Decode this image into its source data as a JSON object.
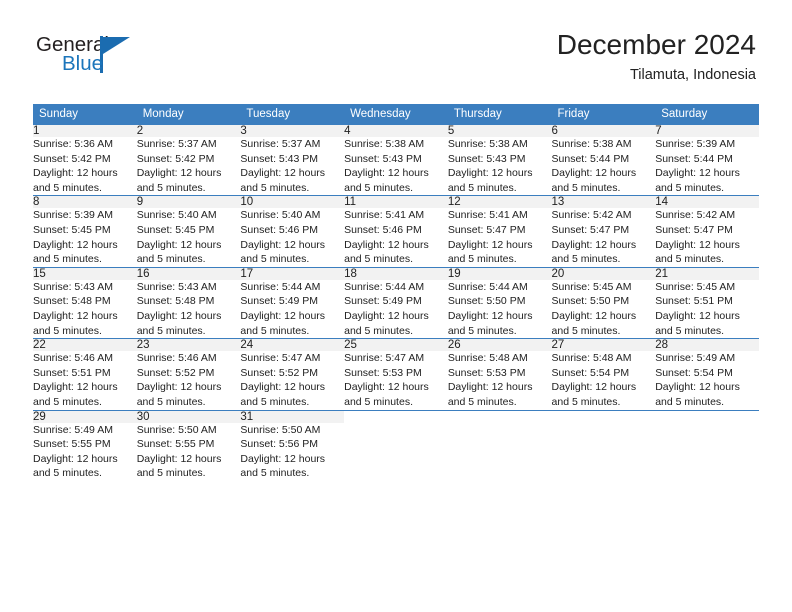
{
  "logo": {
    "primary_text": "General",
    "secondary_text": "Blue",
    "primary_color": "#231f20",
    "secondary_color": "#1b75bb",
    "accent_color": "#1b6cb0",
    "icon": "triangle-flag-icon"
  },
  "header": {
    "title": "December 2024",
    "subtitle": "Tilamuta, Indonesia"
  },
  "theme": {
    "header_row_bg": "#3b7ebf",
    "daynum_bg": "#f2f2f2",
    "text_color": "#222222",
    "cell_bg": "#ffffff"
  },
  "calendar": {
    "weekdays": [
      "Sunday",
      "Monday",
      "Tuesday",
      "Wednesday",
      "Thursday",
      "Friday",
      "Saturday"
    ],
    "labels": {
      "sunrise": "Sunrise:",
      "sunset": "Sunset:",
      "daylight": "Daylight:"
    },
    "weeks": [
      [
        {
          "day": "1",
          "sunrise": "Sunrise: 5:36 AM",
          "sunset": "Sunset: 5:42 PM",
          "daylight_a": "Daylight: 12 hours",
          "daylight_b": "and 5 minutes."
        },
        {
          "day": "2",
          "sunrise": "Sunrise: 5:37 AM",
          "sunset": "Sunset: 5:42 PM",
          "daylight_a": "Daylight: 12 hours",
          "daylight_b": "and 5 minutes."
        },
        {
          "day": "3",
          "sunrise": "Sunrise: 5:37 AM",
          "sunset": "Sunset: 5:43 PM",
          "daylight_a": "Daylight: 12 hours",
          "daylight_b": "and 5 minutes."
        },
        {
          "day": "4",
          "sunrise": "Sunrise: 5:38 AM",
          "sunset": "Sunset: 5:43 PM",
          "daylight_a": "Daylight: 12 hours",
          "daylight_b": "and 5 minutes."
        },
        {
          "day": "5",
          "sunrise": "Sunrise: 5:38 AM",
          "sunset": "Sunset: 5:43 PM",
          "daylight_a": "Daylight: 12 hours",
          "daylight_b": "and 5 minutes."
        },
        {
          "day": "6",
          "sunrise": "Sunrise: 5:38 AM",
          "sunset": "Sunset: 5:44 PM",
          "daylight_a": "Daylight: 12 hours",
          "daylight_b": "and 5 minutes."
        },
        {
          "day": "7",
          "sunrise": "Sunrise: 5:39 AM",
          "sunset": "Sunset: 5:44 PM",
          "daylight_a": "Daylight: 12 hours",
          "daylight_b": "and 5 minutes."
        }
      ],
      [
        {
          "day": "8",
          "sunrise": "Sunrise: 5:39 AM",
          "sunset": "Sunset: 5:45 PM",
          "daylight_a": "Daylight: 12 hours",
          "daylight_b": "and 5 minutes."
        },
        {
          "day": "9",
          "sunrise": "Sunrise: 5:40 AM",
          "sunset": "Sunset: 5:45 PM",
          "daylight_a": "Daylight: 12 hours",
          "daylight_b": "and 5 minutes."
        },
        {
          "day": "10",
          "sunrise": "Sunrise: 5:40 AM",
          "sunset": "Sunset: 5:46 PM",
          "daylight_a": "Daylight: 12 hours",
          "daylight_b": "and 5 minutes."
        },
        {
          "day": "11",
          "sunrise": "Sunrise: 5:41 AM",
          "sunset": "Sunset: 5:46 PM",
          "daylight_a": "Daylight: 12 hours",
          "daylight_b": "and 5 minutes."
        },
        {
          "day": "12",
          "sunrise": "Sunrise: 5:41 AM",
          "sunset": "Sunset: 5:47 PM",
          "daylight_a": "Daylight: 12 hours",
          "daylight_b": "and 5 minutes."
        },
        {
          "day": "13",
          "sunrise": "Sunrise: 5:42 AM",
          "sunset": "Sunset: 5:47 PM",
          "daylight_a": "Daylight: 12 hours",
          "daylight_b": "and 5 minutes."
        },
        {
          "day": "14",
          "sunrise": "Sunrise: 5:42 AM",
          "sunset": "Sunset: 5:47 PM",
          "daylight_a": "Daylight: 12 hours",
          "daylight_b": "and 5 minutes."
        }
      ],
      [
        {
          "day": "15",
          "sunrise": "Sunrise: 5:43 AM",
          "sunset": "Sunset: 5:48 PM",
          "daylight_a": "Daylight: 12 hours",
          "daylight_b": "and 5 minutes."
        },
        {
          "day": "16",
          "sunrise": "Sunrise: 5:43 AM",
          "sunset": "Sunset: 5:48 PM",
          "daylight_a": "Daylight: 12 hours",
          "daylight_b": "and 5 minutes."
        },
        {
          "day": "17",
          "sunrise": "Sunrise: 5:44 AM",
          "sunset": "Sunset: 5:49 PM",
          "daylight_a": "Daylight: 12 hours",
          "daylight_b": "and 5 minutes."
        },
        {
          "day": "18",
          "sunrise": "Sunrise: 5:44 AM",
          "sunset": "Sunset: 5:49 PM",
          "daylight_a": "Daylight: 12 hours",
          "daylight_b": "and 5 minutes."
        },
        {
          "day": "19",
          "sunrise": "Sunrise: 5:44 AM",
          "sunset": "Sunset: 5:50 PM",
          "daylight_a": "Daylight: 12 hours",
          "daylight_b": "and 5 minutes."
        },
        {
          "day": "20",
          "sunrise": "Sunrise: 5:45 AM",
          "sunset": "Sunset: 5:50 PM",
          "daylight_a": "Daylight: 12 hours",
          "daylight_b": "and 5 minutes."
        },
        {
          "day": "21",
          "sunrise": "Sunrise: 5:45 AM",
          "sunset": "Sunset: 5:51 PM",
          "daylight_a": "Daylight: 12 hours",
          "daylight_b": "and 5 minutes."
        }
      ],
      [
        {
          "day": "22",
          "sunrise": "Sunrise: 5:46 AM",
          "sunset": "Sunset: 5:51 PM",
          "daylight_a": "Daylight: 12 hours",
          "daylight_b": "and 5 minutes."
        },
        {
          "day": "23",
          "sunrise": "Sunrise: 5:46 AM",
          "sunset": "Sunset: 5:52 PM",
          "daylight_a": "Daylight: 12 hours",
          "daylight_b": "and 5 minutes."
        },
        {
          "day": "24",
          "sunrise": "Sunrise: 5:47 AM",
          "sunset": "Sunset: 5:52 PM",
          "daylight_a": "Daylight: 12 hours",
          "daylight_b": "and 5 minutes."
        },
        {
          "day": "25",
          "sunrise": "Sunrise: 5:47 AM",
          "sunset": "Sunset: 5:53 PM",
          "daylight_a": "Daylight: 12 hours",
          "daylight_b": "and 5 minutes."
        },
        {
          "day": "26",
          "sunrise": "Sunrise: 5:48 AM",
          "sunset": "Sunset: 5:53 PM",
          "daylight_a": "Daylight: 12 hours",
          "daylight_b": "and 5 minutes."
        },
        {
          "day": "27",
          "sunrise": "Sunrise: 5:48 AM",
          "sunset": "Sunset: 5:54 PM",
          "daylight_a": "Daylight: 12 hours",
          "daylight_b": "and 5 minutes."
        },
        {
          "day": "28",
          "sunrise": "Sunrise: 5:49 AM",
          "sunset": "Sunset: 5:54 PM",
          "daylight_a": "Daylight: 12 hours",
          "daylight_b": "and 5 minutes."
        }
      ],
      [
        {
          "day": "29",
          "sunrise": "Sunrise: 5:49 AM",
          "sunset": "Sunset: 5:55 PM",
          "daylight_a": "Daylight: 12 hours",
          "daylight_b": "and 5 minutes."
        },
        {
          "day": "30",
          "sunrise": "Sunrise: 5:50 AM",
          "sunset": "Sunset: 5:55 PM",
          "daylight_a": "Daylight: 12 hours",
          "daylight_b": "and 5 minutes."
        },
        {
          "day": "31",
          "sunrise": "Sunrise: 5:50 AM",
          "sunset": "Sunset: 5:56 PM",
          "daylight_a": "Daylight: 12 hours",
          "daylight_b": "and 5 minutes."
        },
        {
          "day": "",
          "sunrise": "",
          "sunset": "",
          "daylight_a": "",
          "daylight_b": ""
        },
        {
          "day": "",
          "sunrise": "",
          "sunset": "",
          "daylight_a": "",
          "daylight_b": ""
        },
        {
          "day": "",
          "sunrise": "",
          "sunset": "",
          "daylight_a": "",
          "daylight_b": ""
        },
        {
          "day": "",
          "sunrise": "",
          "sunset": "",
          "daylight_a": "",
          "daylight_b": ""
        }
      ]
    ]
  }
}
